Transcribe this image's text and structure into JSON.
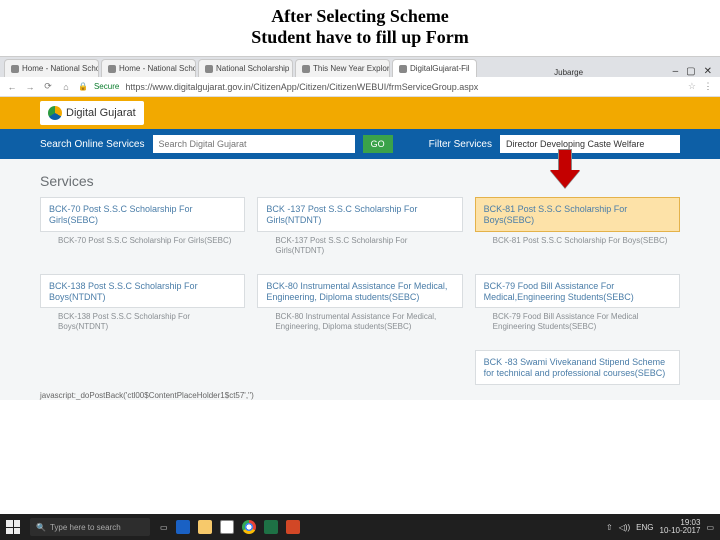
{
  "slide": {
    "title_line1": "After Selecting Scheme",
    "title_line2": "Student have to fill up Form"
  },
  "chrome": {
    "tabs": [
      {
        "label": "Home - National Schola"
      },
      {
        "label": "Home - National Schola"
      },
      {
        "label": "National Scholarship S"
      },
      {
        "label": "This New Year Explore S"
      },
      {
        "label": "DigitalGujarat-Fil"
      }
    ],
    "identity": "Jubarge",
    "window": {
      "min": "–",
      "max": "▢",
      "close": "✕"
    },
    "nav": {
      "back": "←",
      "fwd": "→",
      "reload": "⟳",
      "home": "⌂"
    },
    "secure": "Secure",
    "url": "https://www.digitalgujarat.gov.in/CitizenApp/Citizen/CitizenWEBUI/frmServiceGroup.aspx",
    "star": "☆",
    "menu": "⋮"
  },
  "header": {
    "logo_text": "Digital Gujarat"
  },
  "searchbar": {
    "search_label": "Search Online Services",
    "search_placeholder": "Search Digital Gujarat",
    "go": "GO",
    "filter_label": "Filter Services",
    "filter_value": "Director Developing Caste Welfare"
  },
  "services": {
    "heading": "Services",
    "rows": [
      [
        {
          "title": "BCK-70 Post S.S.C Scholarship For Girls(SEBC)",
          "sub": "BCK-70 Post S.S.C Scholarship For Girls(SEBC)",
          "hl": false
        },
        {
          "title": "BCK -137 Post S.S.C Scholarship For Girls(NTDNT)",
          "sub": "BCK-137 Post S.S.C Scholarship For Girls(NTDNT)",
          "hl": false
        },
        {
          "title": "BCK-81 Post S.S.C Scholarship For Boys(SEBC)",
          "sub": "BCK-81 Post S.S.C Scholarship For Boys(SEBC)",
          "hl": true
        }
      ],
      [
        {
          "title": "BCK-138 Post S.S.C Scholarship For Boys(NTDNT)",
          "sub": "BCK-138 Post S.S.C Scholarship For Boys(NTDNT)",
          "hl": false
        },
        {
          "title": "BCK-80 Instrumental Assistance For Medical, Engineering, Diploma students(SEBC)",
          "sub": "BCK-80 Instrumental Assistance For Medical, Engineering, Diploma students(SEBC)",
          "hl": false
        },
        {
          "title": "BCK-79 Food Bill Assistance For Medical,Engineering Students(SEBC)",
          "sub": "BCK-79 Food Bill Assistance For Medical Engineering Students(SEBC)",
          "hl": false
        }
      ],
      [
        {
          "title": "",
          "sub": "",
          "hl": false
        },
        {
          "title": "",
          "sub": "",
          "hl": false
        },
        {
          "title": "BCK -83 Swami Vivekanand Stipend Scheme for technical and professional courses(SEBC)",
          "sub": "",
          "hl": false
        }
      ]
    ]
  },
  "statusbar": "javascript:_doPostBack('ctl00$ContentPlaceHolder1$ct57','')",
  "taskbar": {
    "search_placeholder": "Type here to search",
    "sys": {
      "wifi": "⇧",
      "net": "◁))",
      "lang": "ENG"
    },
    "time": "19:03",
    "date": "10-10-2017"
  }
}
